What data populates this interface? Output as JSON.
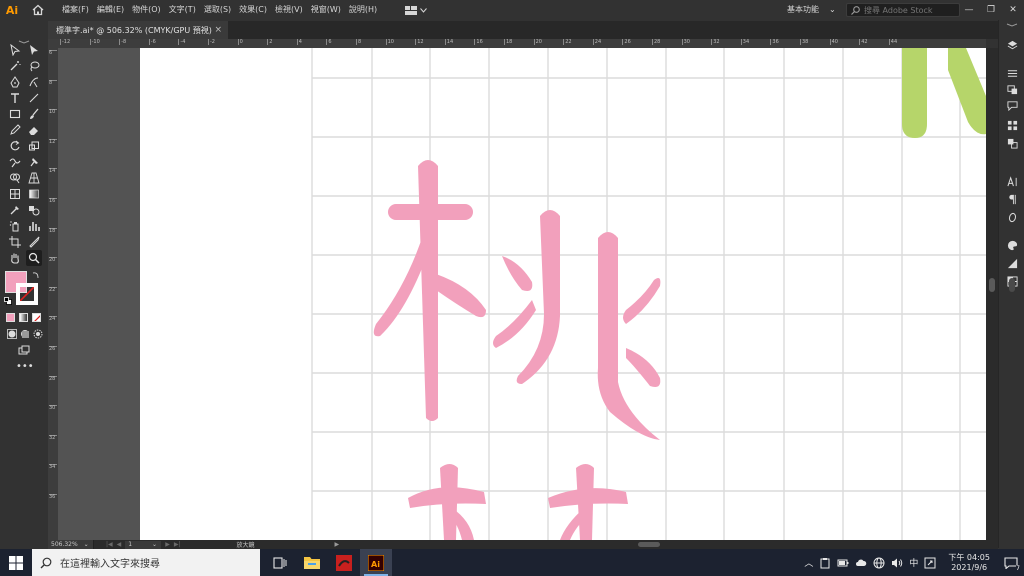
{
  "app": {
    "logo": "Ai",
    "home_icon": "home-icon"
  },
  "menus": [
    "檔案(F)",
    "編輯(E)",
    "物件(O)",
    "文字(T)",
    "選取(S)",
    "效果(C)",
    "檢視(V)",
    "視窗(W)",
    "說明(H)"
  ],
  "workspace": {
    "label": "基本功能",
    "chevron": "⌄"
  },
  "stock_search": {
    "placeholder": "搜尋 Adobe Stock"
  },
  "window_controls": {
    "minimize": "—",
    "restore": "❐",
    "close": "✕"
  },
  "tab": {
    "title": "標準字.ai* @ 506.32% (CMYK/GPU 預視)",
    "close": "×"
  },
  "ruler_top_labels": [
    "-12",
    "-10",
    "-8",
    "-6",
    "-4",
    "-2",
    "0",
    "2",
    "4",
    "6",
    "8",
    "10",
    "12",
    "14",
    "16",
    "18",
    "20",
    "22",
    "24",
    "26",
    "28",
    "30",
    "32",
    "34",
    "36",
    "38",
    "40",
    "42",
    "44"
  ],
  "ruler_left_labels": [
    "6",
    "8",
    "10",
    "12",
    "14",
    "16",
    "18",
    "20",
    "22",
    "24",
    "26",
    "28",
    "30",
    "32",
    "34",
    "36"
  ],
  "status": {
    "zoom": "506.32%",
    "zoom_chevron": "⌄",
    "nav_first": "|◀",
    "nav_prev": "◀",
    "artboard": "1",
    "artboard_chevron": "⌄",
    "nav_next": "▶",
    "nav_last": "▶|",
    "tool_name": "放大鏡",
    "tool_arrow": "▶"
  },
  "colors": {
    "glyph_pink": "#f2a0bc",
    "accent_green": "#b6d56a",
    "grid": "#dcdcdc",
    "ai_orange": "#ff9a00"
  },
  "taskbar": {
    "search_placeholder": "在這裡輸入文字來搜尋",
    "ime": "中",
    "clock_time": "下午 04:05",
    "clock_date": "2021/9/6",
    "notifications": "7",
    "chevron_up": "︿"
  }
}
